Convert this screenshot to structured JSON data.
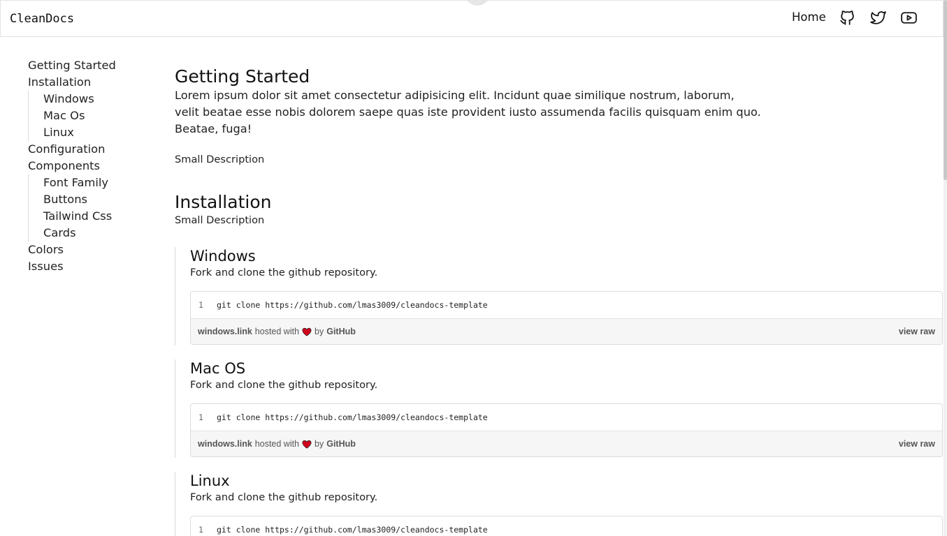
{
  "header": {
    "brand": "CleanDocs",
    "nav_home": "Home",
    "icons": [
      "github-icon",
      "twitter-icon",
      "youtube-icon"
    ]
  },
  "sidebar": {
    "items": [
      {
        "label": "Getting Started"
      },
      {
        "label": "Installation",
        "children": [
          {
            "label": "Windows"
          },
          {
            "label": "Mac Os"
          },
          {
            "label": "Linux"
          }
        ]
      },
      {
        "label": "Configuration"
      },
      {
        "label": "Components",
        "children": [
          {
            "label": "Font Family"
          },
          {
            "label": "Buttons"
          },
          {
            "label": "Tailwind Css"
          },
          {
            "label": "Cards"
          }
        ]
      },
      {
        "label": "Colors"
      },
      {
        "label": "Issues"
      }
    ]
  },
  "main": {
    "getting_started": {
      "title": "Getting Started",
      "text": "Lorem ipsum dolor sit amet consectetur adipisicing elit. Incidunt quae similique nostrum, laborum, velit beatae esse nobis dolorem saepe quas iste provident iusto assumenda facilis quisquam enim quo. Beatae, fuga!",
      "small": "Small Description"
    },
    "installation": {
      "title": "Installation",
      "small": "Small Description",
      "sections": [
        {
          "title": "Windows",
          "desc": "Fork and clone the github repository.",
          "line_no": "1",
          "code": "git clone https://github.com/lmas3009/cleandocs-template",
          "file": "windows.link",
          "hosted": "hosted with",
          "by": "by",
          "host": "GitHub",
          "raw": "view raw"
        },
        {
          "title": "Mac OS",
          "desc": "Fork and clone the github repository.",
          "line_no": "1",
          "code": "git clone https://github.com/lmas3009/cleandocs-template",
          "file": "windows.link",
          "hosted": "hosted with",
          "by": "by",
          "host": "GitHub",
          "raw": "view raw"
        },
        {
          "title": "Linux",
          "desc": "Fork and clone the github repository.",
          "line_no": "1",
          "code": "git clone https://github.com/lmas3009/cleandocs-template"
        }
      ]
    }
  },
  "colors": {
    "heart": "#d0021b",
    "border": "#dcdcdc"
  }
}
